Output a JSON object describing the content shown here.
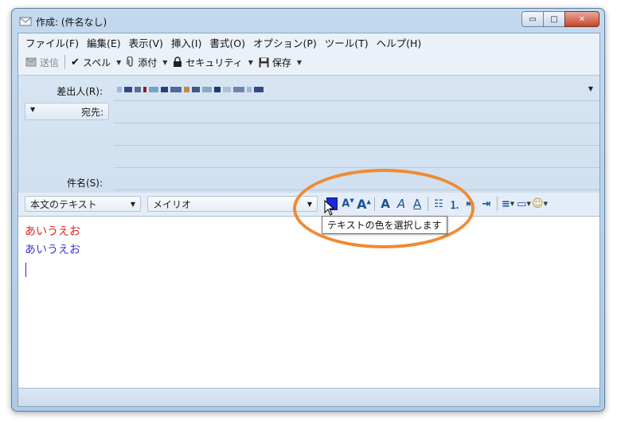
{
  "window": {
    "title": "作成: (件名なし)",
    "buttons": {
      "minimize": "▭",
      "maximize": "□",
      "close": "✕"
    }
  },
  "menubar": {
    "items": [
      "ファイル(F)",
      "編集(E)",
      "表示(V)",
      "挿入(I)",
      "書式(O)",
      "オプション(P)",
      "ツール(T)",
      "ヘルプ(H)"
    ]
  },
  "toolbar": {
    "send": "送信",
    "spell": "スペル",
    "attach": "添付",
    "security": "セキュリティ",
    "save": "保存"
  },
  "headers": {
    "from_label": "差出人(R):",
    "to_type": "宛先:",
    "subject_label": "件名(S):"
  },
  "format": {
    "paragraph_style": "本文のテキスト",
    "font": "メイリオ",
    "text_color_hex": "#1b28d8"
  },
  "editor": {
    "lines": [
      {
        "text": "あいうえお",
        "color": "#e0201a"
      },
      {
        "text": "あいうえお",
        "color": "#3a3ad8"
      }
    ]
  },
  "tooltip": {
    "text": "テキストの色を選択します"
  },
  "icons": {
    "send": "send-icon",
    "spell": "checkmark-icon",
    "attach": "paperclip-icon",
    "security": "lock-icon",
    "save": "floppy-icon"
  },
  "colors": {
    "annotation_ellipse": "#f08a33"
  }
}
